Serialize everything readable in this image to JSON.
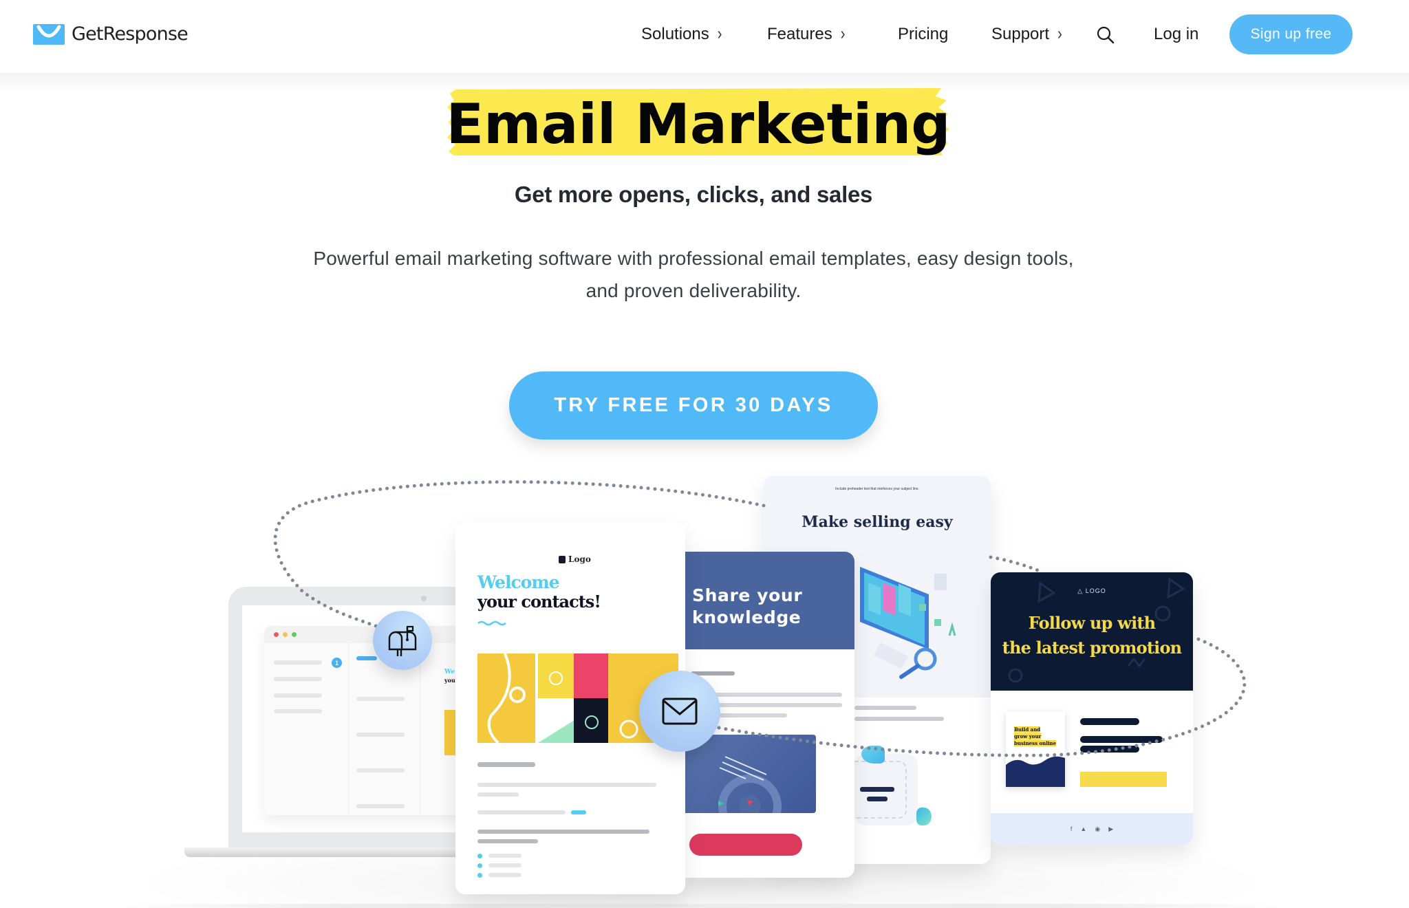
{
  "header": {
    "brand": "GetResponse",
    "nav": [
      {
        "label": "Solutions",
        "has_submenu": true
      },
      {
        "label": "Features",
        "has_submenu": true
      },
      {
        "label": "Pricing",
        "has_submenu": false
      },
      {
        "label": "Support",
        "has_submenu": true
      }
    ],
    "search_icon": "search-icon",
    "login_label": "Log in",
    "signup_label": "Sign up free"
  },
  "hero": {
    "title": "Email Marketing",
    "subtitle": "Get more opens, clicks, and sales",
    "description_line1": "Powerful email marketing software with professional email templates, easy design tools,",
    "description_line2": "and proven deliverability.",
    "cta_label": "TRY FREE FOR 30 DAYS"
  },
  "illustration": {
    "laptop_badge": "1",
    "laptop_preview_line1": "We",
    "laptop_preview_line2": "you",
    "welcome_card": {
      "logo": "Logo",
      "line1": "Welcome",
      "line2": "your contacts!"
    },
    "share_card": {
      "title_line1": "Share your",
      "title_line2": "knowledge"
    },
    "selling_card": {
      "preheader": "Include preheader text that reinforces your subject line.",
      "title": "Make selling easy"
    },
    "promo_card": {
      "logo": "LOGO",
      "title_line1": "Follow up with",
      "title_line2": "the latest promotion",
      "ebook_line1": "Build and",
      "ebook_line2": "grow your",
      "ebook_line3": "business online",
      "social": [
        "f",
        "t",
        "ig",
        "yt"
      ]
    },
    "bubbles": [
      "mailbox-icon",
      "envelope-icon"
    ]
  },
  "colors": {
    "brand_blue": "#55b9f8",
    "highlight_yellow": "#fbe94f",
    "share_blue": "#4a649e",
    "promo_navy": "#0d1a33",
    "promo_yellow": "#f4d94a",
    "cta_red": "#db3a5d"
  }
}
